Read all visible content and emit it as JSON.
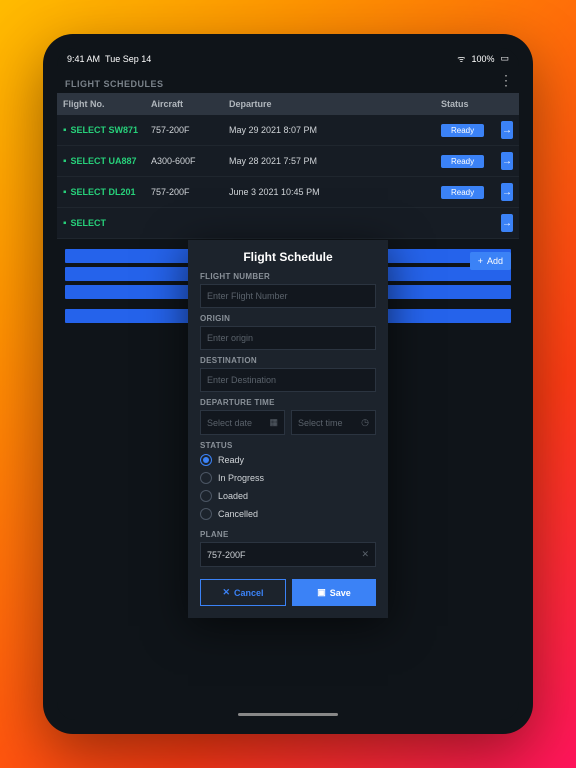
{
  "statusbar": {
    "time": "9:41 AM",
    "date": "Tue Sep 14",
    "battery": "100%"
  },
  "section": {
    "title": "FLIGHT SCHEDULES",
    "add_label": "Add"
  },
  "columns": {
    "no": "Flight No.",
    "ac": "Aircraft",
    "dep": "Departure",
    "status": "Status"
  },
  "rows": [
    {
      "select": "SELECT SW871",
      "ac": "757-200F",
      "dep": "May 29 2021 8:07 PM",
      "status": "Ready"
    },
    {
      "select": "SELECT UA887",
      "ac": "A300-600F",
      "dep": "May 28 2021 7:57 PM",
      "status": "Ready"
    },
    {
      "select": "SELECT DL201",
      "ac": "757-200F",
      "dep": "June 3 2021 10:45 PM",
      "status": "Ready"
    },
    {
      "select": "SELECT",
      "ac": "",
      "dep": "",
      "status": ""
    }
  ],
  "modal": {
    "title": "Flight Schedule",
    "flight_number_label": "FLIGHT NUMBER",
    "flight_number_placeholder": "Enter Flight Number",
    "origin_label": "ORIGIN",
    "origin_placeholder": "Enter origin",
    "destination_label": "DESTINATION",
    "destination_placeholder": "Enter Destination",
    "departure_label": "DEPARTURE TIME",
    "date_placeholder": "Select date",
    "time_placeholder": "Select time",
    "status_label": "STATUS",
    "status_options": {
      "ready": "Ready",
      "inprogress": "In Progress",
      "loaded": "Loaded",
      "cancelled": "Cancelled"
    },
    "plane_label": "PLANE",
    "plane_value": "757-200F",
    "cancel_label": "Cancel",
    "save_label": "Save"
  }
}
